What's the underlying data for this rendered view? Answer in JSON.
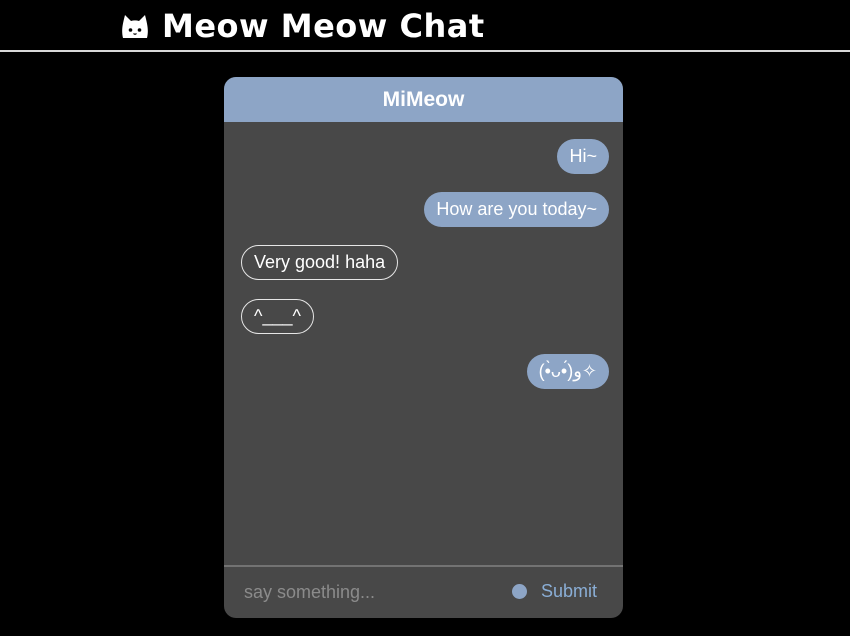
{
  "app": {
    "title": "Meow Meow Chat",
    "logo_icon": "cat-face-icon"
  },
  "chat": {
    "contact_name": "MiMeow",
    "messages": [
      {
        "direction": "outgoing",
        "text": "Hi~"
      },
      {
        "direction": "outgoing",
        "text": "How are you today~"
      },
      {
        "direction": "incoming",
        "text": "Very good! haha"
      },
      {
        "direction": "incoming",
        "text": "^___^"
      },
      {
        "direction": "outgoing",
        "text": "(•̀ᴗ•́)و✧"
      }
    ]
  },
  "composer": {
    "placeholder": "say something...",
    "value": "",
    "submit_label": "Submit",
    "status_icon": "status-dot-icon"
  },
  "colors": {
    "accent": "#8da5c6",
    "panel_bg": "#484848",
    "page_bg": "#000000",
    "submit_text": "#8aaed6"
  }
}
